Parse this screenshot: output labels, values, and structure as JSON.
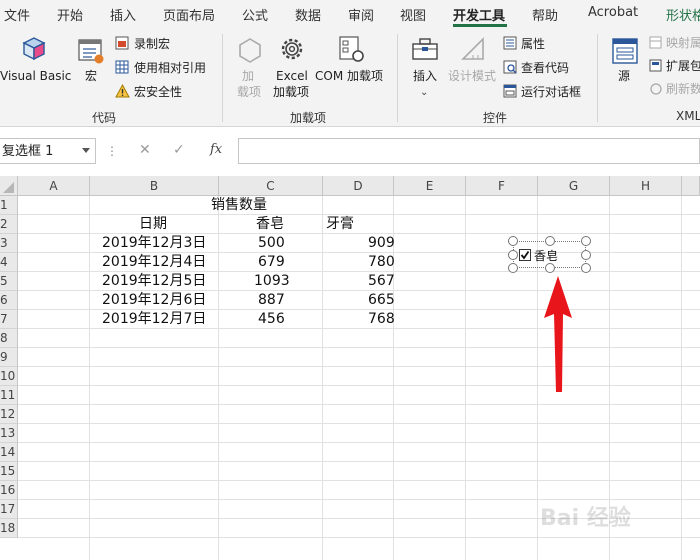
{
  "tabs": [
    "文件",
    "开始",
    "插入",
    "页面布局",
    "公式",
    "数据",
    "审阅",
    "视图",
    "开发工具",
    "帮助",
    "Acrobat",
    "形状格"
  ],
  "active_tab": "开发工具",
  "ribbon": {
    "visual_basic": "Visual Basic",
    "macros": "宏",
    "record_macro": "录制宏",
    "use_relative": "使用相对引用",
    "macro_security": "宏安全性",
    "group_code": "代码",
    "addins_1": "加",
    "addins_2": "载项",
    "excel_addins_1": "Excel",
    "excel_addins_2": "加载项",
    "com_addins": "COM 加载项",
    "group_addins": "加载项",
    "insert": "插入",
    "design_mode": "设计模式",
    "properties": "属性",
    "view_code": "查看代码",
    "run_dialog": "运行对话框",
    "group_controls": "控件",
    "source": "源",
    "map_props": "映射属",
    "expand_pack": "扩展包",
    "refresh_data": "刷新数",
    "group_xml": "XML"
  },
  "formula_bar": {
    "name_box": "复选框 1",
    "cancel": "✕",
    "enter": "✓",
    "fx": "fx",
    "value": ""
  },
  "columns": [
    "A",
    "B",
    "C",
    "D",
    "E",
    "F",
    "G",
    "H"
  ],
  "rows": [
    "1",
    "2",
    "3",
    "4",
    "5",
    "6",
    "7",
    "8",
    "9",
    "10",
    "11",
    "12",
    "13",
    "14",
    "15",
    "16",
    "17",
    "18"
  ],
  "sheet": {
    "title": "销售数量",
    "headers": [
      "日期",
      "香皂",
      "牙膏"
    ],
    "data": [
      [
        "2019年12月3日",
        "500",
        "909"
      ],
      [
        "2019年12月4日",
        "679",
        "780"
      ],
      [
        "2019年12月5日",
        "1093",
        "567"
      ],
      [
        "2019年12月6日",
        "887",
        "665"
      ],
      [
        "2019年12月7日",
        "456",
        "768"
      ]
    ]
  },
  "checkbox": {
    "label": "香皂",
    "checked": true
  },
  "watermark": "Bai 经验",
  "colors": {
    "accent": "#217346",
    "arrow": "#e8151b"
  }
}
